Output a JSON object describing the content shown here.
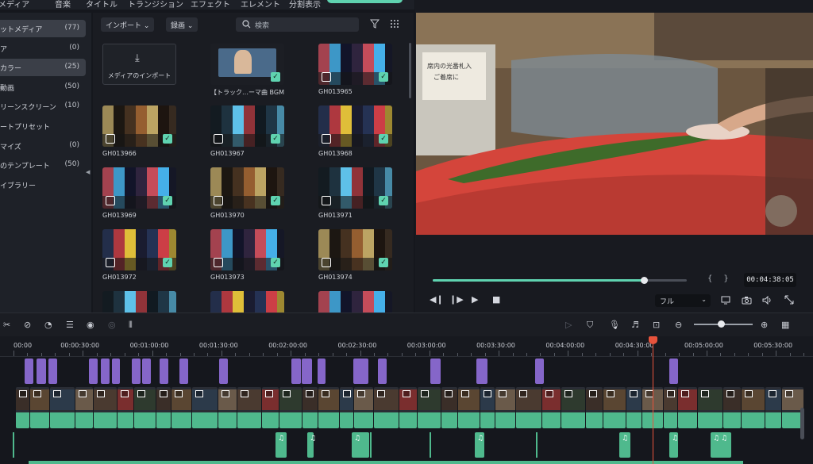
{
  "top_tabs": [
    "メディア",
    "音楽",
    "タイトル",
    "トランジション",
    "エフェクト",
    "エレメント",
    "分割表示"
  ],
  "sidebar": {
    "items": [
      {
        "label": "ットメディア",
        "count": "(77)",
        "active": true
      },
      {
        "label": "ア",
        "count": "(0)",
        "active": false
      },
      {
        "label": "カラー",
        "count": "(25)",
        "active": true
      },
      {
        "label": "動画",
        "count": "(50)",
        "active": false
      },
      {
        "label": "リーンスクリーン",
        "count": "(10)",
        "active": false
      },
      {
        "label": "ートプリセット",
        "count": "",
        "active": false
      },
      {
        "label": "マイズ",
        "count": "(0)",
        "active": false
      },
      {
        "label": "のテンプレート",
        "count": "(50)",
        "active": false
      },
      {
        "label": "イブラリー",
        "count": "",
        "active": false
      }
    ],
    "collapse_icon": "triangle-left-icon"
  },
  "media": {
    "import_dropdown": "インポート",
    "record_dropdown": "録画",
    "search_placeholder": "検索",
    "import_tile_label": "メディアのインポート",
    "tiles": [
      {
        "name": "【トラック…ーマ曲 BGM",
        "checked": true,
        "kind": "audio"
      },
      {
        "name": "GH013965",
        "checked": true,
        "kind": "video"
      },
      {
        "name": "GH013966",
        "checked": true,
        "kind": "video"
      },
      {
        "name": "GH013967",
        "checked": true,
        "kind": "video"
      },
      {
        "name": "GH013968",
        "checked": true,
        "kind": "video"
      },
      {
        "name": "GH013969",
        "checked": true,
        "kind": "video"
      },
      {
        "name": "GH013970",
        "checked": true,
        "kind": "video"
      },
      {
        "name": "GH013971",
        "checked": true,
        "kind": "video"
      },
      {
        "name": "GH013972",
        "checked": true,
        "kind": "video"
      },
      {
        "name": "GH013973",
        "checked": true,
        "kind": "video"
      },
      {
        "name": "GH013974",
        "checked": true,
        "kind": "video"
      },
      {
        "name": "",
        "checked": false,
        "kind": "video"
      },
      {
        "name": "",
        "checked": false,
        "kind": "video"
      },
      {
        "name": "",
        "checked": false,
        "kind": "video"
      }
    ]
  },
  "preview": {
    "progress": 0.83,
    "mark_in": "{",
    "mark_out": "}",
    "timecode": "00:04:38:05",
    "quality": "フル",
    "sign_text": "席内の光番札入  ご着席に  お持ちください"
  },
  "timeline": {
    "ruler_labels": [
      "00:00",
      "00:00:30:00",
      "00:01:00:00",
      "00:01:30:00",
      "00:02:00:00",
      "00:02:30:00",
      "00:03:00:00",
      "00:03:30:00",
      "00:04:00:00",
      "00:04:30:00",
      "00:05:00:00",
      "00:05:30:00"
    ],
    "playhead_time": "00:04:38:05"
  },
  "colors": {
    "accent": "#5fd3b0",
    "audio_track": "#4fb98d",
    "title_track": "#8566c9",
    "playhead": "#e8533c"
  }
}
